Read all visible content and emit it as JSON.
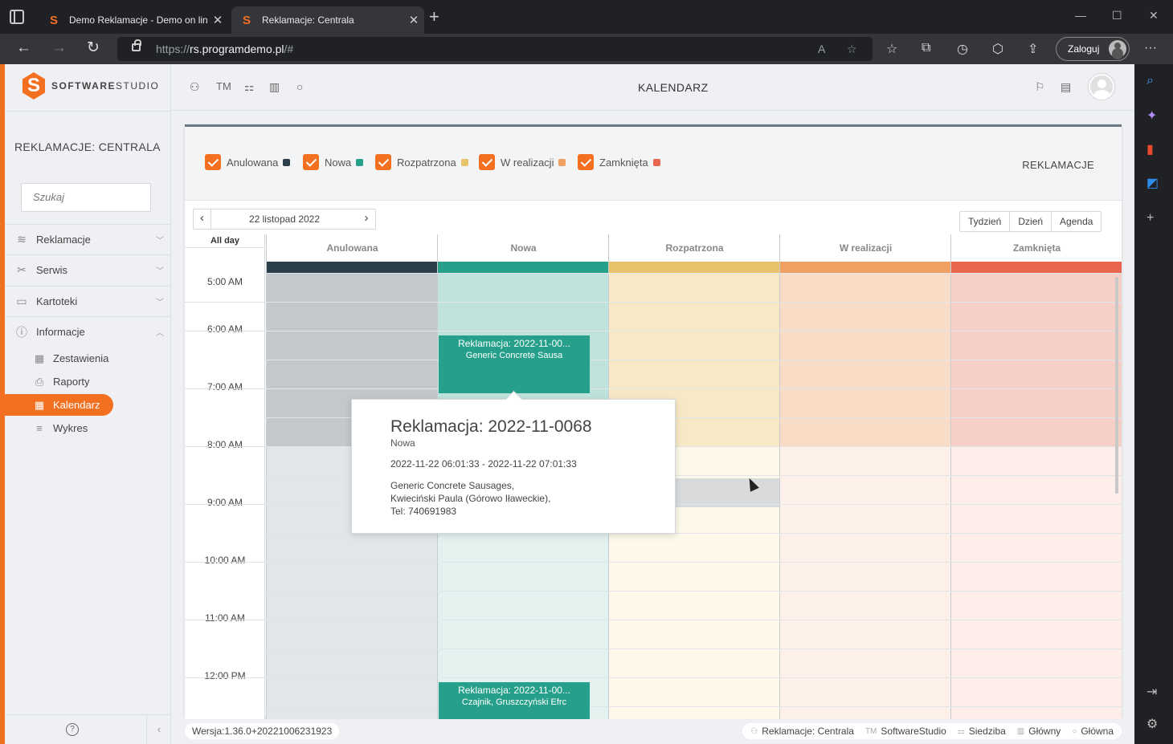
{
  "browser": {
    "tabs": [
      {
        "title": "Demo Reklamacje - Demo on lin"
      },
      {
        "title": "Reklamacje: Centrala"
      }
    ],
    "url_prefix": "https://",
    "url_host": "rs.programdemo.pl",
    "url_path": "/#",
    "login_label": "Zaloguj"
  },
  "app": {
    "logo_bold": "SOFTWARE",
    "logo_light": "STUDIO",
    "section_title": "REKLAMACJE: CENTRALA",
    "search_placeholder": "Szukaj",
    "page_title": "KALENDARZ",
    "topbar_tm": "TM"
  },
  "menu": [
    {
      "label": "Reklamacje",
      "icon": "layers-icon"
    },
    {
      "label": "Serwis",
      "icon": "tools-icon"
    },
    {
      "label": "Kartoteki",
      "icon": "folder-icon"
    },
    {
      "label": "Informacje",
      "icon": "info-icon"
    }
  ],
  "submenu": [
    {
      "label": "Zestawienia",
      "icon": "table-icon"
    },
    {
      "label": "Raporty",
      "icon": "printer-icon"
    },
    {
      "label": "Kalendarz",
      "icon": "calendar-icon",
      "active": true
    },
    {
      "label": "Wykres",
      "icon": "chart-icon"
    }
  ],
  "filters": [
    {
      "label": "Anulowana",
      "color": "#2c3e4a"
    },
    {
      "label": "Nowa",
      "color": "#26a08a"
    },
    {
      "label": "Rozpatrzona",
      "color": "#e8c26a"
    },
    {
      "label": "W realizacji",
      "color": "#f0a060"
    },
    {
      "label": "Zamknięta",
      "color": "#e8654f"
    }
  ],
  "card_label": "REKLAMACJE",
  "calendar": {
    "date_label": "22 listopad 2022",
    "views": [
      "Tydzień",
      "Dzień",
      "Agenda"
    ],
    "all_day": "All day",
    "times": [
      "5:00 AM",
      "6:00 AM",
      "7:00 AM",
      "8:00 AM",
      "9:00 AM",
      "10:00 AM",
      "11:00 AM",
      "12:00 PM"
    ],
    "resources": [
      "Anulowana",
      "Nowa",
      "Rozpatrzona",
      "W realizacji",
      "Zamknięta"
    ],
    "events": [
      {
        "title": "Reklamacja: 2022-11-00...",
        "subtitle": "Generic Concrete Sausa"
      },
      {
        "title": "Reklamacja: 2022-11-00...",
        "subtitle": "Czajnik, Gruszczyński Efrc"
      }
    ]
  },
  "popup": {
    "title": "Reklamacja: 2022-11-0068",
    "status": "Nowa",
    "time": "2022-11-22 06:01:33 - 2022-11-22 07:01:33",
    "line1": "Generic Concrete Sausages,",
    "line2": "Kwieciński Paula (Górowo Iławeckie),",
    "line3": "Tel: 740691983"
  },
  "footer": {
    "version": "Wersja:1.36.0+20221006231923",
    "context": [
      "Reklamacje: Centrala",
      "SoftwareStudio",
      "Siedziba",
      "Główny",
      "Główna"
    ]
  }
}
